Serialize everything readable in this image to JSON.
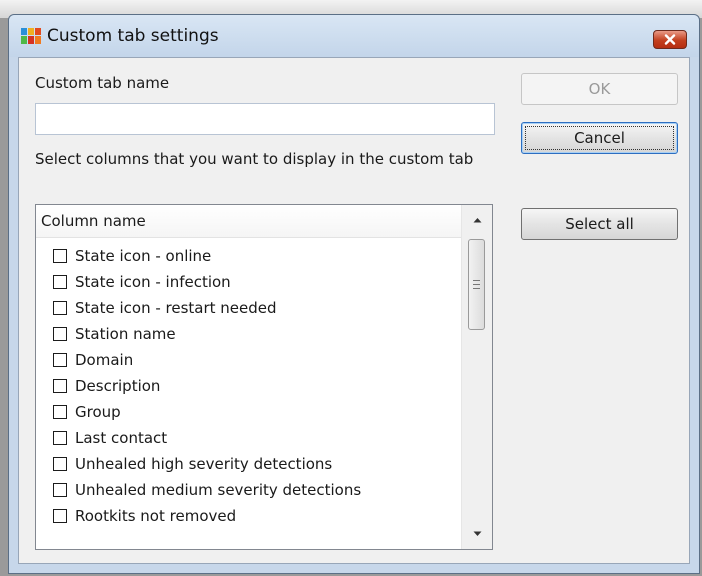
{
  "window": {
    "title": "Custom tab settings"
  },
  "form": {
    "name_label": "Custom tab name",
    "name_value": "",
    "columns_instruction": "Select columns that you want to display in the custom tab"
  },
  "buttons": {
    "ok": "OK",
    "cancel": "Cancel",
    "select_all": "Select all"
  },
  "columns_list": {
    "header": "Column name",
    "items": [
      {
        "label": "State icon - online",
        "checked": false
      },
      {
        "label": "State icon - infection",
        "checked": false
      },
      {
        "label": "State icon - restart needed",
        "checked": false
      },
      {
        "label": "Station name",
        "checked": false
      },
      {
        "label": "Domain",
        "checked": false
      },
      {
        "label": "Description",
        "checked": false
      },
      {
        "label": "Group",
        "checked": false
      },
      {
        "label": "Last contact",
        "checked": false
      },
      {
        "label": "Unhealed high severity detections",
        "checked": false
      },
      {
        "label": "Unhealed medium severity detections",
        "checked": false
      },
      {
        "label": "Rootkits not removed",
        "checked": false
      }
    ]
  },
  "icons": {
    "app": "avg-logo-icon",
    "close": "close-icon",
    "scroll_up": "scroll-up-arrow-icon",
    "scroll_down": "scroll-down-arrow-icon"
  },
  "colors": {
    "titlebar": "#c7d7ea",
    "close_button": "#c3401f",
    "default_button_border": "#2d6ec0"
  }
}
